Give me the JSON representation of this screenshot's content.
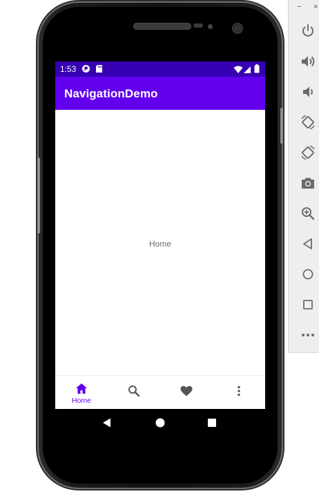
{
  "status_bar": {
    "time": "1:53",
    "background": "#3700b3"
  },
  "app_bar": {
    "title": "NavigationDemo",
    "background": "#6200ee"
  },
  "content": {
    "label": "Home"
  },
  "bottom_nav": {
    "active_color": "#6200ee",
    "inactive_color": "#555555",
    "items": [
      {
        "label": "Home",
        "icon": "home-icon",
        "active": true
      },
      {
        "label": "",
        "icon": "search-icon",
        "active": false
      },
      {
        "label": "",
        "icon": "heart-icon",
        "active": false
      },
      {
        "label": "",
        "icon": "more-vert-icon",
        "active": false
      }
    ]
  },
  "system_nav": {
    "buttons": [
      "back-icon",
      "home-circle-icon",
      "recents-icon"
    ]
  },
  "emulator_toolbar": {
    "window_controls": {
      "minimize": "−",
      "close": "×"
    },
    "tools": [
      "power-icon",
      "volume-up-icon",
      "volume-down-icon",
      "rotate-left-icon",
      "rotate-right-icon",
      "camera-icon",
      "zoom-icon",
      "back-triangle-icon",
      "home-circle-icon",
      "overview-square-icon",
      "more-icon"
    ]
  }
}
